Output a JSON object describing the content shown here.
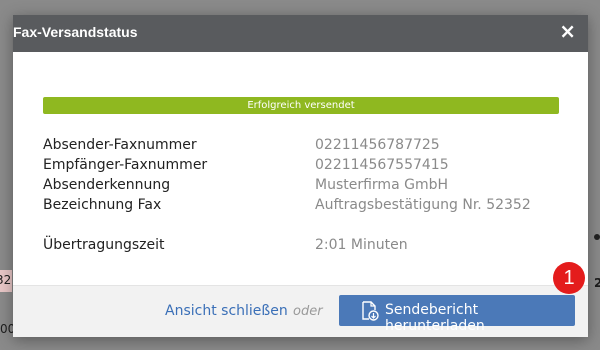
{
  "dialog": {
    "title": "Fax-Versandstatus",
    "close_glyph": "×",
    "status": {
      "label": "Erfolgreich versendet",
      "color": "#8fb820"
    },
    "fields": [
      {
        "label": "Absender-Faxnummer",
        "value": "02211456787725"
      },
      {
        "label": "Empfänger-Faxnummer",
        "value": "022114567557415"
      },
      {
        "label": "Absenderkennung",
        "value": "Musterfirma GmbH"
      },
      {
        "label": "Bezeichnung Fax",
        "value": "Auftragsbestätigung Nr. 52352"
      }
    ],
    "transfer": {
      "label": "Übertragungszeit",
      "value": "2:01 Minuten"
    },
    "footer": {
      "close_link": "Ansicht schließen",
      "or_text": "oder",
      "download_button": "Sendebericht herunterladen",
      "download_icon": "document-download-icon"
    }
  },
  "annotation": {
    "step_number": "1",
    "color": "#e41c1c"
  },
  "background": {
    "fragment_left_1": "32",
    "fragment_left_2": "00",
    "fragment_right": "2"
  },
  "colors": {
    "header": "#595b5e",
    "primary_button": "#4b79b8",
    "link": "#3a6fb7",
    "overlay": "#8a8a8a"
  }
}
